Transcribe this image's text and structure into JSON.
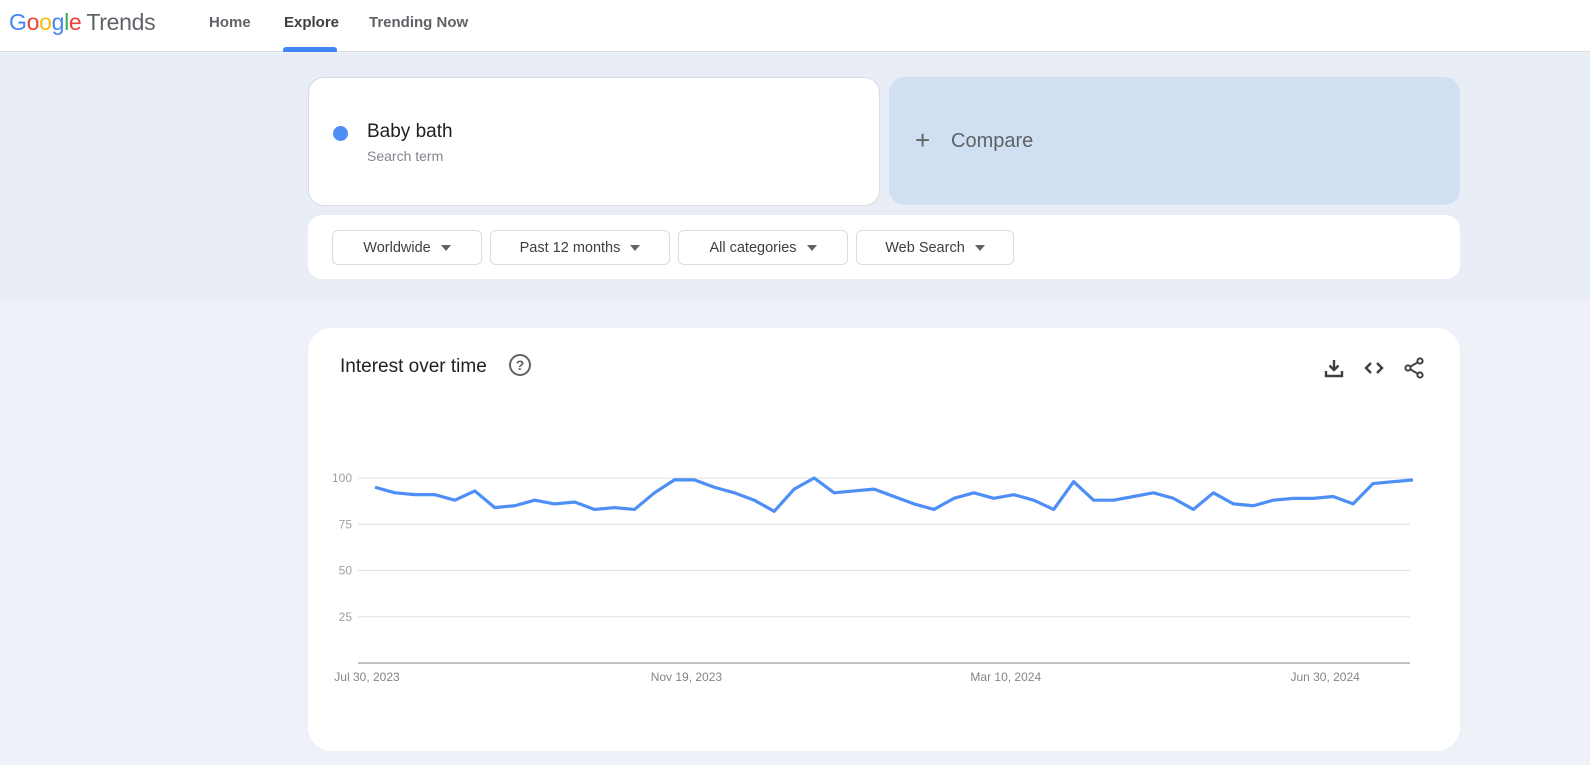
{
  "header": {
    "logo": {
      "google": [
        "G",
        "o",
        "o",
        "g",
        "l",
        "e"
      ],
      "product": "Trends"
    },
    "nav": [
      {
        "label": "Home",
        "active": false
      },
      {
        "label": "Explore",
        "active": true
      },
      {
        "label": "Trending Now",
        "active": false
      }
    ]
  },
  "search": {
    "term": "Baby bath",
    "term_type": "Search term",
    "term_color": "#4e8ef7",
    "compare_label": "Compare",
    "compare_icon": "plus-icon"
  },
  "filters": [
    {
      "label": "Worldwide"
    },
    {
      "label": "Past 12 months"
    },
    {
      "label": "All categories"
    },
    {
      "label": "Web Search"
    }
  ],
  "interest_card": {
    "title": "Interest over time",
    "help_icon": "help-circle-icon",
    "tools": [
      "download-icon",
      "embed-code-icon",
      "share-icon"
    ]
  },
  "chart_data": {
    "type": "line",
    "title": "Interest over time",
    "xlabel": "",
    "ylabel": "",
    "ylim": [
      0,
      100
    ],
    "yticks": [
      25,
      50,
      75,
      100
    ],
    "grid": true,
    "x_tick_labels": [
      {
        "label": "Jul 30, 2023",
        "index": 0
      },
      {
        "label": "Nov 19, 2023",
        "index": 16
      },
      {
        "label": "Mar 10, 2024",
        "index": 32
      },
      {
        "label": "Jun 30, 2024",
        "index": 48
      }
    ],
    "series": [
      {
        "name": "Baby bath",
        "color": "#4e8ef7",
        "values": [
          95,
          92,
          91,
          91,
          88,
          93,
          84,
          85,
          88,
          86,
          87,
          83,
          84,
          83,
          92,
          99,
          99,
          95,
          92,
          88,
          82,
          94,
          100,
          92,
          93,
          94,
          90,
          86,
          83,
          89,
          92,
          89,
          91,
          88,
          83,
          98,
          88,
          88,
          90,
          92,
          89,
          83,
          92,
          86,
          85,
          88,
          89,
          89,
          90,
          86,
          97,
          98,
          99
        ]
      }
    ]
  }
}
